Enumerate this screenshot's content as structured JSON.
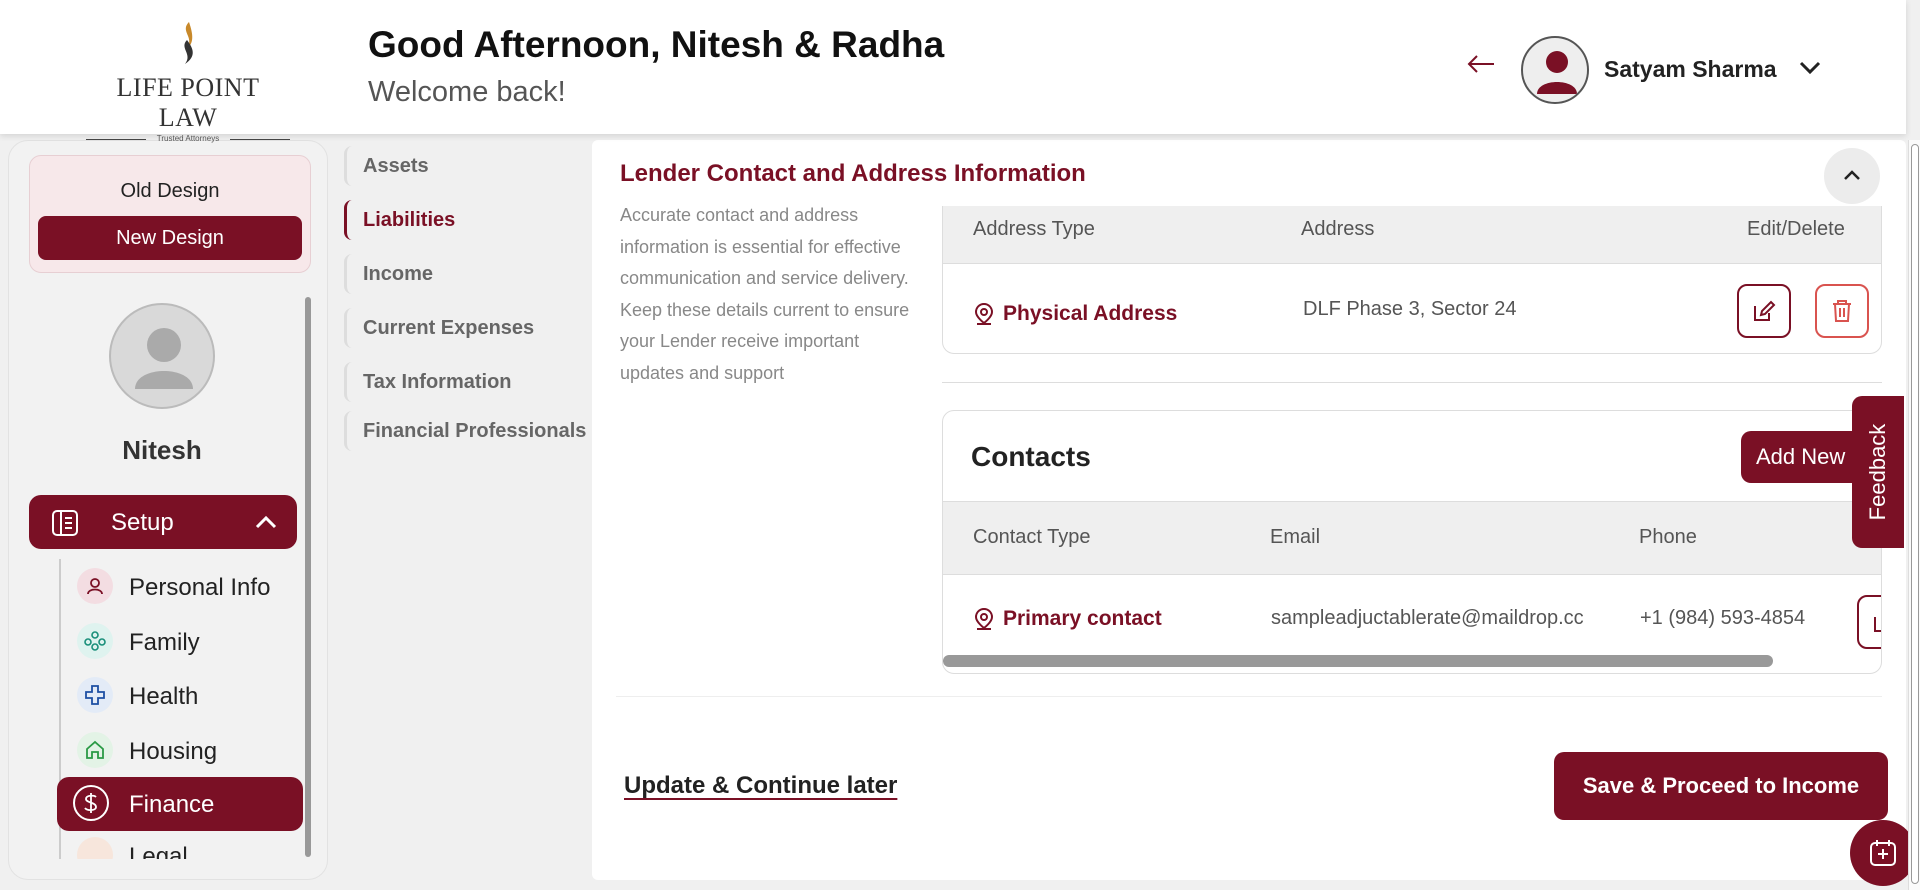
{
  "header": {
    "logo_name": "LIFE POINT LAW",
    "logo_tagline": "Trusted Attorneys",
    "greeting": "Good Afternoon, Nitesh & Radha",
    "welcome": "Welcome back!",
    "user_name": "Satyam Sharma"
  },
  "sidebar": {
    "old_design": "Old Design",
    "new_design": "New Design",
    "profile_name": "Nitesh",
    "setup_label": "Setup",
    "items": [
      {
        "label": "Personal Info",
        "icon": "person-icon",
        "color": "#f3dde2"
      },
      {
        "label": "Family",
        "icon": "family-icon",
        "color": "#dff3ef"
      },
      {
        "label": "Health",
        "icon": "health-cross-icon",
        "color": "#e3ebf7"
      },
      {
        "label": "Housing",
        "icon": "house-icon",
        "color": "#e3f3e6"
      },
      {
        "label": "Finance",
        "icon": "dollar-icon",
        "active": true
      },
      {
        "label": "Legal",
        "icon": "legal-icon",
        "color": "#f7e6dc"
      }
    ]
  },
  "subnav": {
    "items": [
      "Assets",
      "Liabilities",
      "Income",
      "Current Expenses",
      "Tax Information",
      "Financial Professionals"
    ],
    "active": "Liabilities"
  },
  "section": {
    "title": "Lender Contact and Address Information",
    "description": "Accurate contact and address information is essential for effective communication and service delivery. Keep these details current to ensure your Lender receive important updates and support"
  },
  "address_table": {
    "headers": [
      "Address Type",
      "Address",
      "Edit/Delete"
    ],
    "rows": [
      {
        "type": "Physical Address",
        "address": "DLF Phase 3, Sector 24"
      }
    ]
  },
  "contacts": {
    "title": "Contacts",
    "add_new": "Add New",
    "headers": [
      "Contact Type",
      "Email",
      "Phone"
    ],
    "rows": [
      {
        "type": "Primary contact",
        "email": "sampleadjuctablerate@maildrop.cc",
        "phone": "+1 (984) 593-4854"
      }
    ]
  },
  "footer": {
    "update_later": "Update & Continue later",
    "save_proceed": "Save & Proceed to Income"
  },
  "feedback_label": "Feedback",
  "colors": {
    "brand": "#7a1025",
    "delete": "#d9534f"
  }
}
